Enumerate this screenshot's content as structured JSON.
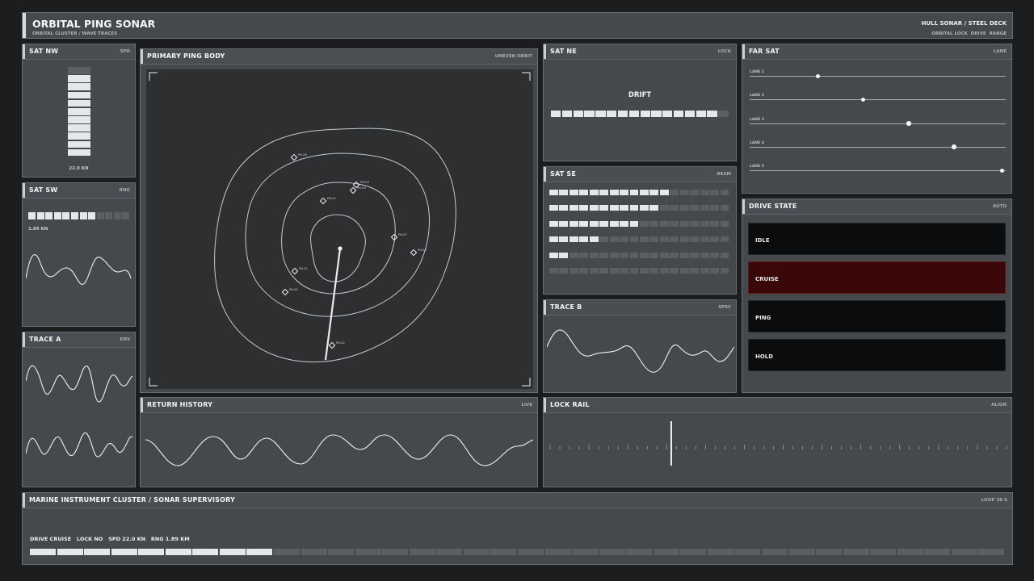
{
  "header": {
    "title": "ORBITAL PING SONAR",
    "subtitle": "ORBITAL CLUSTER / WAVE TRACES",
    "right_title": "HULL SONAR / STEEL DECK",
    "right_links": [
      "ORBITAL LOCK",
      "DRIVE",
      "RANGE"
    ]
  },
  "sat_nw": {
    "title": "SAT NW",
    "tag": "SPD",
    "readout": "22.0 KN",
    "level": 10,
    "segments": 11
  },
  "sat_sw": {
    "title": "SAT SW",
    "tag": "RNG",
    "readout": "1.89 KN",
    "level": 8,
    "segments": 12
  },
  "trace_a": {
    "title": "TRACE A",
    "tag": "ENV"
  },
  "primary": {
    "title": "PRIMARY  PING BODY",
    "tag": "UNEVEN ORBIT",
    "contacts": [
      {
        "label": "PN-06"
      },
      {
        "label": "PN-05"
      },
      {
        "label": "PN-02"
      },
      {
        "label": "PN-04"
      },
      {
        "label": "PN-07"
      },
      {
        "label": "PN-08"
      },
      {
        "label": "PN-01"
      },
      {
        "label": "PN-03"
      },
      {
        "label": "PN-02"
      }
    ]
  },
  "sat_ne": {
    "title": "SAT NE",
    "tag": "LOCK",
    "label": "DRIFT",
    "level": 15,
    "segments": 16
  },
  "sat_se": {
    "title": "SAT SE",
    "tag": "BEAM",
    "segments": 18,
    "rows": [
      12,
      11,
      9,
      5,
      2,
      0
    ]
  },
  "trace_b": {
    "title": "TRACE B",
    "tag": "SPEC"
  },
  "far_sat": {
    "title": "FAR SAT",
    "tag": "LANE",
    "lanes": [
      {
        "label": "LANE 1",
        "value": 0.27
      },
      {
        "label": "LANE 2",
        "value": 0.45
      },
      {
        "label": "LANE 3",
        "value": 0.63
      },
      {
        "label": "LANE 4",
        "value": 0.81
      },
      {
        "label": "LANE 5",
        "value": 1.0
      }
    ]
  },
  "drive_state": {
    "title": "DRIVE STATE",
    "tag": "AUTO",
    "states": [
      "IDLE",
      "CRUISE",
      "PING",
      "HOLD"
    ],
    "active": "CRUISE"
  },
  "return_history": {
    "title": "RETURN HISTORY",
    "tag": "LIVE"
  },
  "lock_rail": {
    "title": "LOCK RAIL",
    "tag": "ALIGN",
    "position": 0.26
  },
  "footer": {
    "title": "MARINE INSTRUMENT CLUSTER  /  SONAR SUPERVISORY",
    "tag": "LOOP 38 S",
    "status": "DRIVE CRUISE   LOCK NO   SPD 22.0 KN   RNG 1.89 KM",
    "progress": 9,
    "segments": 36
  },
  "colors": {
    "panel": "#45494c",
    "border": "#6a6f73",
    "segment_on": "#e3e8ea",
    "segment_off": "#5a5f63",
    "active_state": "#3a0808",
    "inactive_state": "#0b0c0d"
  }
}
